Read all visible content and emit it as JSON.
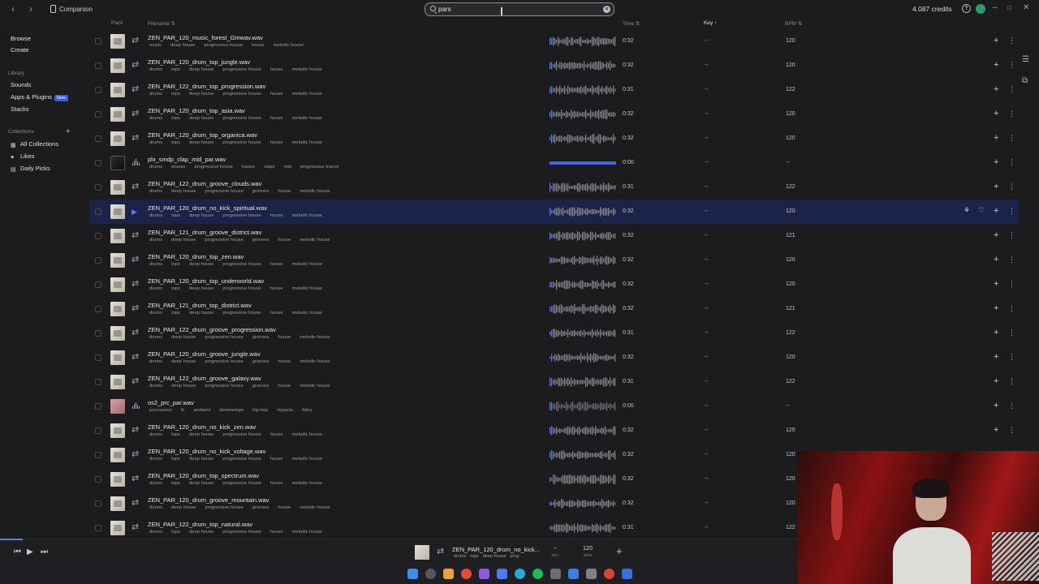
{
  "titlebar": {
    "app_name": "Companion",
    "search_value": "pars",
    "credits": "4.087 credits"
  },
  "columns": {
    "pack": "Pack",
    "filename": "Filename",
    "time": "Time",
    "key": "Key",
    "bpm": "BPM"
  },
  "sidebar": {
    "browse": "Browse",
    "create": "Create",
    "library_heading": "Library",
    "sounds": "Sounds",
    "apps_plugins": "Apps & Plugins",
    "new_badge": "New",
    "stacks": "Stacks",
    "collections_heading": "Collections",
    "all_collections": "All Collections",
    "likes": "Likes",
    "daily_picks": "Daily Picks"
  },
  "rows": [
    {
      "name": "ZEN_PAR_120_music_forest_Gmwav.wav",
      "tags": [
        "music",
        "deep house",
        "progressive house",
        "house",
        "melodic house"
      ],
      "time": "0:32",
      "key": "--",
      "bpm": "120",
      "kind": "loop",
      "thumb": "light"
    },
    {
      "name": "ZEN_PAR_120_drum_top_jungle.wav",
      "tags": [
        "drums",
        "tops",
        "deep house",
        "progressive house",
        "house",
        "melodic house"
      ],
      "time": "0:32",
      "key": "--",
      "bpm": "120",
      "kind": "loop",
      "thumb": "light"
    },
    {
      "name": "ZEN_PAR_122_drum_top_progression.wav",
      "tags": [
        "drums",
        "tops",
        "deep house",
        "progressive house",
        "house",
        "melodic house"
      ],
      "time": "0:31",
      "key": "--",
      "bpm": "122",
      "kind": "loop",
      "thumb": "light"
    },
    {
      "name": "ZEN_PAR_120_drum_top_asia.wav",
      "tags": [
        "drums",
        "tops",
        "deep house",
        "progressive house",
        "house",
        "melodic house"
      ],
      "time": "0:32",
      "key": "--",
      "bpm": "120",
      "kind": "loop",
      "thumb": "light"
    },
    {
      "name": "ZEN_PAR_120_drum_top_organica.wav",
      "tags": [
        "drums",
        "tops",
        "deep house",
        "progressive house",
        "house",
        "melodic house"
      ],
      "time": "0:32",
      "key": "--",
      "bpm": "120",
      "kind": "loop",
      "thumb": "light"
    },
    {
      "name": "plx_smdp_clap_mid_par.wav",
      "tags": [
        "drums",
        "snares",
        "progressive house",
        "trance",
        "claps",
        "mid",
        "progressive trance"
      ],
      "time": "0:00",
      "key": "--",
      "bpm": "--",
      "kind": "oneshot",
      "thumb": "dark"
    },
    {
      "name": "ZEN_PAR_122_drum_groove_clouds.wav",
      "tags": [
        "drums",
        "deep house",
        "progressive house",
        "grooves",
        "house",
        "melodic house"
      ],
      "time": "0:31",
      "key": "--",
      "bpm": "122",
      "kind": "loop",
      "thumb": "light"
    },
    {
      "name": "ZEN_PAR_120_drum_no_kick_spiritual.wav",
      "tags": [
        "drums",
        "tops",
        "deep house",
        "progressive house",
        "house",
        "melodic house"
      ],
      "time": "0:32",
      "key": "--",
      "bpm": "120",
      "kind": "play",
      "thumb": "light",
      "selected": true
    },
    {
      "name": "ZEN_PAR_121_drum_groove_district.wav",
      "tags": [
        "drums",
        "deep house",
        "progressive house",
        "grooves",
        "house",
        "melodic house"
      ],
      "time": "0:32",
      "key": "--",
      "bpm": "121",
      "kind": "loop",
      "thumb": "light"
    },
    {
      "name": "ZEN_PAR_120_drum_top_zen.wav",
      "tags": [
        "drums",
        "tops",
        "deep house",
        "progressive house",
        "house",
        "melodic house"
      ],
      "time": "0:32",
      "key": "--",
      "bpm": "120",
      "kind": "loop",
      "thumb": "light"
    },
    {
      "name": "ZEN_PAR_120_drum_top_underworld.wav",
      "tags": [
        "drums",
        "tops",
        "deep house",
        "progressive house",
        "house",
        "melodic house"
      ],
      "time": "0:32",
      "key": "--",
      "bpm": "120",
      "kind": "loop",
      "thumb": "light"
    },
    {
      "name": "ZEN_PAR_121_drum_top_district.wav",
      "tags": [
        "drums",
        "tops",
        "deep house",
        "progressive house",
        "house",
        "melodic house"
      ],
      "time": "0:32",
      "key": "--",
      "bpm": "121",
      "kind": "loop",
      "thumb": "light"
    },
    {
      "name": "ZEN_PAR_122_drum_groove_progression.wav",
      "tags": [
        "drums",
        "deep house",
        "progressive house",
        "grooves",
        "house",
        "melodic house"
      ],
      "time": "0:31",
      "key": "--",
      "bpm": "122",
      "kind": "loop",
      "thumb": "light"
    },
    {
      "name": "ZEN_PAR_120_drum_groove_jungle.wav",
      "tags": [
        "drums",
        "deep house",
        "progressive house",
        "grooves",
        "house",
        "melodic house"
      ],
      "time": "0:32",
      "key": "--",
      "bpm": "120",
      "kind": "loop",
      "thumb": "light"
    },
    {
      "name": "ZEN_PAR_122_drum_groove_galaxy.wav",
      "tags": [
        "drums",
        "deep house",
        "progressive house",
        "grooves",
        "house",
        "melodic house"
      ],
      "time": "0:31",
      "key": "--",
      "bpm": "122",
      "kind": "loop",
      "thumb": "light"
    },
    {
      "name": "os2_prc_par.wav",
      "tags": [
        "percussion",
        "fx",
        "ambient",
        "downtempo",
        "hip hop",
        "impacts",
        "foley"
      ],
      "time": "0:00",
      "key": "--",
      "bpm": "--",
      "kind": "oneshot",
      "thumb": "pink"
    },
    {
      "name": "ZEN_PAR_120_drum_no_kick_zen.wav",
      "tags": [
        "drums",
        "tops",
        "deep house",
        "progressive house",
        "house",
        "melodic house"
      ],
      "time": "0:32",
      "key": "--",
      "bpm": "120",
      "kind": "loop",
      "thumb": "light"
    },
    {
      "name": "ZEN_PAR_120_drum_no_kick_voltage.wav",
      "tags": [
        "drums",
        "tops",
        "deep house",
        "progressive house",
        "house",
        "melodic house"
      ],
      "time": "0:32",
      "key": "--",
      "bpm": "120",
      "kind": "loop",
      "thumb": "light"
    },
    {
      "name": "ZEN_PAR_120_drum_top_spectrum.wav",
      "tags": [
        "drums",
        "tops",
        "deep house",
        "progressive house",
        "house",
        "melodic house"
      ],
      "time": "0:32",
      "key": "--",
      "bpm": "120",
      "kind": "loop",
      "thumb": "light"
    },
    {
      "name": "ZEN_PAR_120_drum_groove_mountain.wav",
      "tags": [
        "drums",
        "deep house",
        "progressive house",
        "grooves",
        "house",
        "melodic house"
      ],
      "time": "0:32",
      "key": "--",
      "bpm": "120",
      "kind": "loop",
      "thumb": "light"
    },
    {
      "name": "ZEN_PAR_122_drum_top_natural.wav",
      "tags": [
        "drums",
        "tops",
        "deep house",
        "progressive house",
        "house",
        "melodic house"
      ],
      "time": "0:31",
      "key": "--",
      "bpm": "122",
      "kind": "loop",
      "thumb": "light"
    }
  ],
  "player": {
    "name": "ZEN_PAR_120_drum_no_kick...",
    "tags": [
      "drums",
      "tops",
      "deep house",
      "prog"
    ],
    "key": "--",
    "key_label": "KEY",
    "bpm": "120",
    "bpm_label": "BPM"
  },
  "icons": {
    "back": "chevron-left-icon",
    "forward": "chevron-right-icon",
    "loop": "loop-icon",
    "oneshot": "waveform-icon",
    "add": "plus-icon",
    "more": "more-vertical-icon"
  },
  "colors": {
    "accent": "#5b7cff",
    "selected_row": "#1c2349",
    "background": "#1c1c1e",
    "new_badge": "#3b5bdb"
  }
}
